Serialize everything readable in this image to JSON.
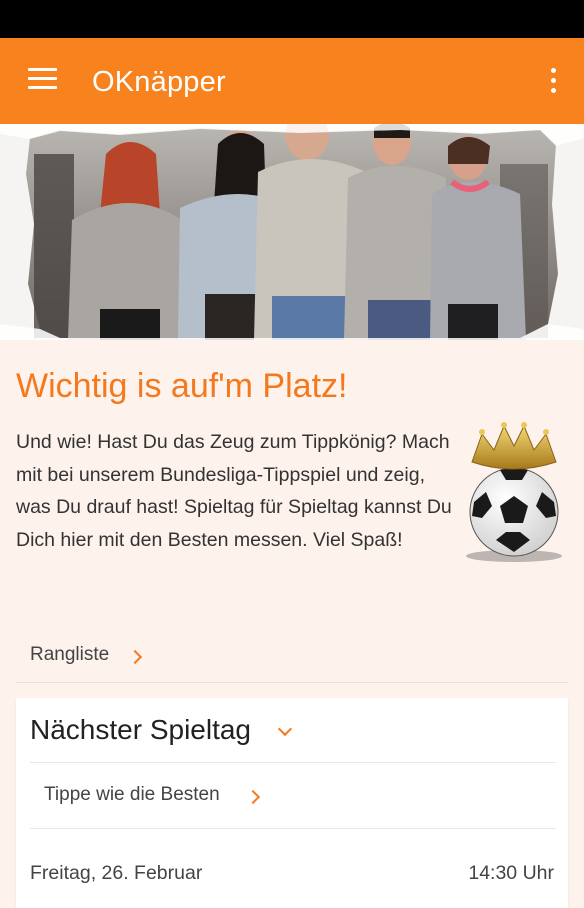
{
  "app": {
    "title": "OKnäpper"
  },
  "intro": {
    "headline": "Wichtig is auf'm Platz!",
    "text": "Und wie! Hast Du das Zeug zum Tippkönig? Mach mit bei unserem Bundesliga-Tippspiel und zeig, was Du drauf hast! Spieltag für Spieltag kannst Du Dich hier mit den Besten messen. Viel Spaß!"
  },
  "links": {
    "rangliste": "Rangliste"
  },
  "next_matchday": {
    "title": "Nächster Spieltag",
    "tipp_link": "Tippe wie die Besten",
    "date": "Freitag, 26. Februar",
    "time": "14:30 Uhr"
  },
  "colors": {
    "accent": "#f7821e",
    "headline": "#f4791e",
    "background": "#fdf2ec"
  },
  "icons": {
    "menu": "menu-icon",
    "overflow": "more-vert-icon",
    "ball": "soccer-ball-crown-icon",
    "chevron_right": "chevron-right-icon",
    "chevron_down": "chevron-down-icon"
  }
}
